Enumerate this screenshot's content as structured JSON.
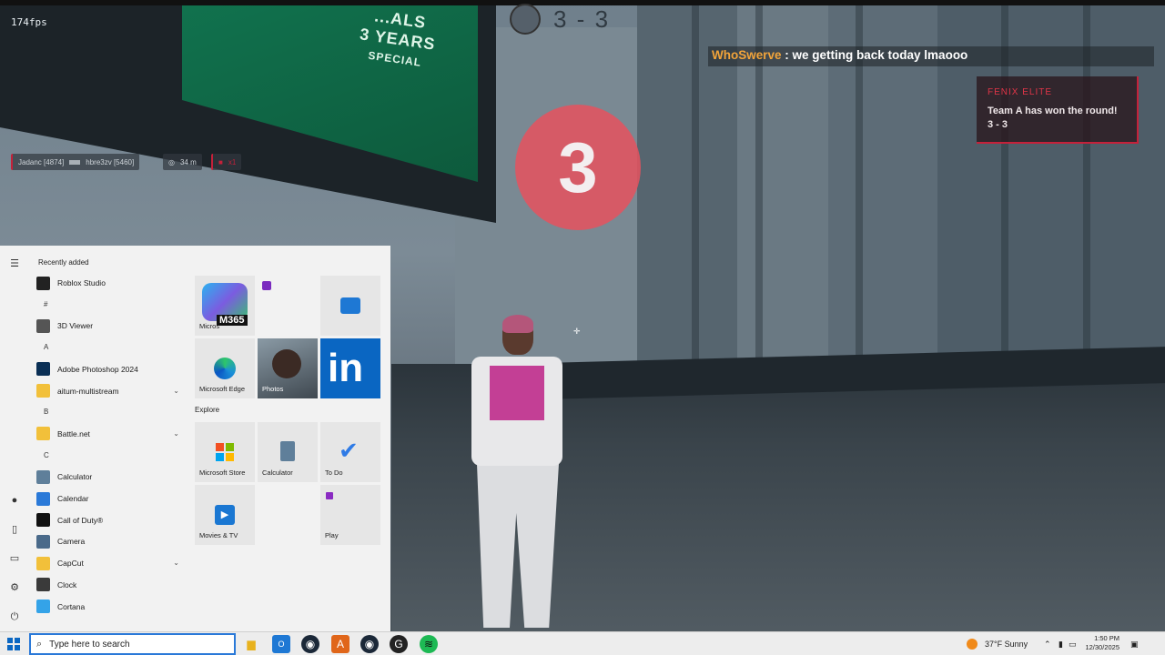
{
  "game": {
    "fps": "174fps",
    "score": "3 - 3",
    "billboard": [
      "...ALS",
      "3 YEARS",
      "SPECIAL"
    ],
    "chat": {
      "user": "WhoSwerve",
      "separator": " : ",
      "message": "we getting back today lmaooo"
    },
    "notice": {
      "header": "FENIX ELITE",
      "line1": "Team A has won the round!",
      "line2": "3 - 3"
    },
    "countdown": "3",
    "killfeed": {
      "killer": "Jadanc [4874]",
      "victim": "hbre3zv [5460]",
      "distance": "34 m",
      "extra": "x1"
    }
  },
  "start_menu": {
    "recently_added": "Recently added",
    "apps": [
      {
        "label": "Roblox Studio",
        "icon": "roblox-icon",
        "color": "#222222"
      },
      {
        "letter": "#"
      },
      {
        "label": "3D Viewer",
        "icon": "cube-icon",
        "color": "#555555"
      },
      {
        "letter": "A"
      },
      {
        "label": "Adobe Photoshop 2024",
        "icon": "photoshop-icon",
        "color": "#0a2f55"
      },
      {
        "label": "aitum-multistream",
        "icon": "folder-icon",
        "color": "#f2c03a",
        "expandable": true
      },
      {
        "letter": "B"
      },
      {
        "label": "Battle.net",
        "icon": "folder-icon",
        "color": "#f2c03a",
        "expandable": true
      },
      {
        "letter": "C"
      },
      {
        "label": "Calculator",
        "icon": "calculator-icon",
        "color": "#5f7f9a"
      },
      {
        "label": "Calendar",
        "icon": "calendar-icon",
        "color": "#2a79d8"
      },
      {
        "label": "Call of Duty®",
        "icon": "cod-icon",
        "color": "#111111"
      },
      {
        "label": "Camera",
        "icon": "camera-icon",
        "color": "#4a6a8a"
      },
      {
        "label": "CapCut",
        "icon": "folder-icon",
        "color": "#f2c03a",
        "expandable": true
      },
      {
        "label": "Clock",
        "icon": "clock-icon",
        "color": "#3a3a3a"
      },
      {
        "label": "Cortana",
        "icon": "cortana-icon",
        "color": "#34a3e8"
      }
    ],
    "tiles": [
      {
        "label": "Microsoft 365",
        "badge": "M365"
      },
      {
        "label": "",
        "small": true
      },
      {
        "label": ""
      },
      {
        "label": "Microsoft Edge"
      },
      {
        "label": "Photos"
      },
      {
        "label": "",
        "logo": "in"
      },
      {
        "label": "Microsoft Store"
      },
      {
        "label": "Calculator"
      },
      {
        "label": "To Do"
      },
      {
        "label": "Movies & TV"
      },
      {
        "label": "Play"
      }
    ],
    "explore": "Explore"
  },
  "taskbar": {
    "search_placeholder": "Type here to search",
    "weather": "37°F  Sunny",
    "time": "1:50 PM",
    "date": "12/30/2025",
    "colors": {
      "accent": "#0b67c2",
      "search_border": "#2a79d8",
      "spotify": "#1db954"
    }
  }
}
